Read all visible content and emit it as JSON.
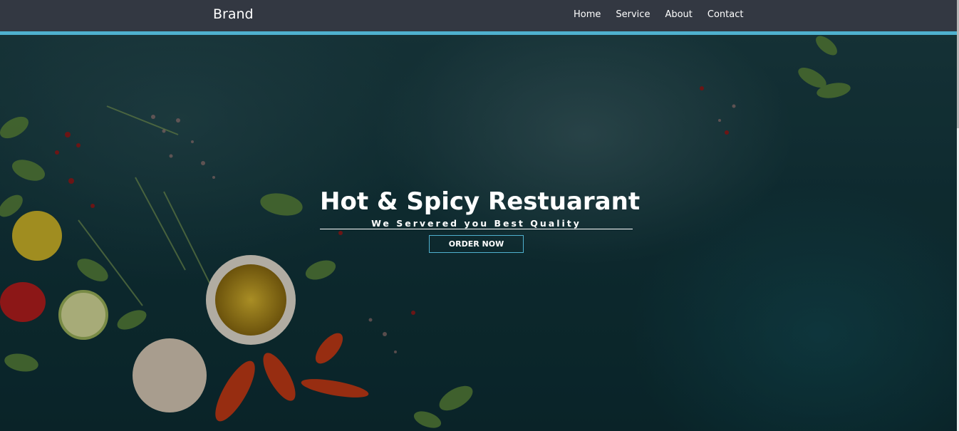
{
  "navbar": {
    "brand": "Brand",
    "links": [
      "Home",
      "Service",
      "About",
      "Contact"
    ]
  },
  "hero": {
    "title": "Hot & Spicy Restuarant",
    "subtitle": "We Servered you Best Quality",
    "cta_label": "ORDER NOW"
  },
  "colors": {
    "nav_bg": "#333842",
    "accent": "#4fb1cf",
    "hero_bg": "#12363c"
  }
}
